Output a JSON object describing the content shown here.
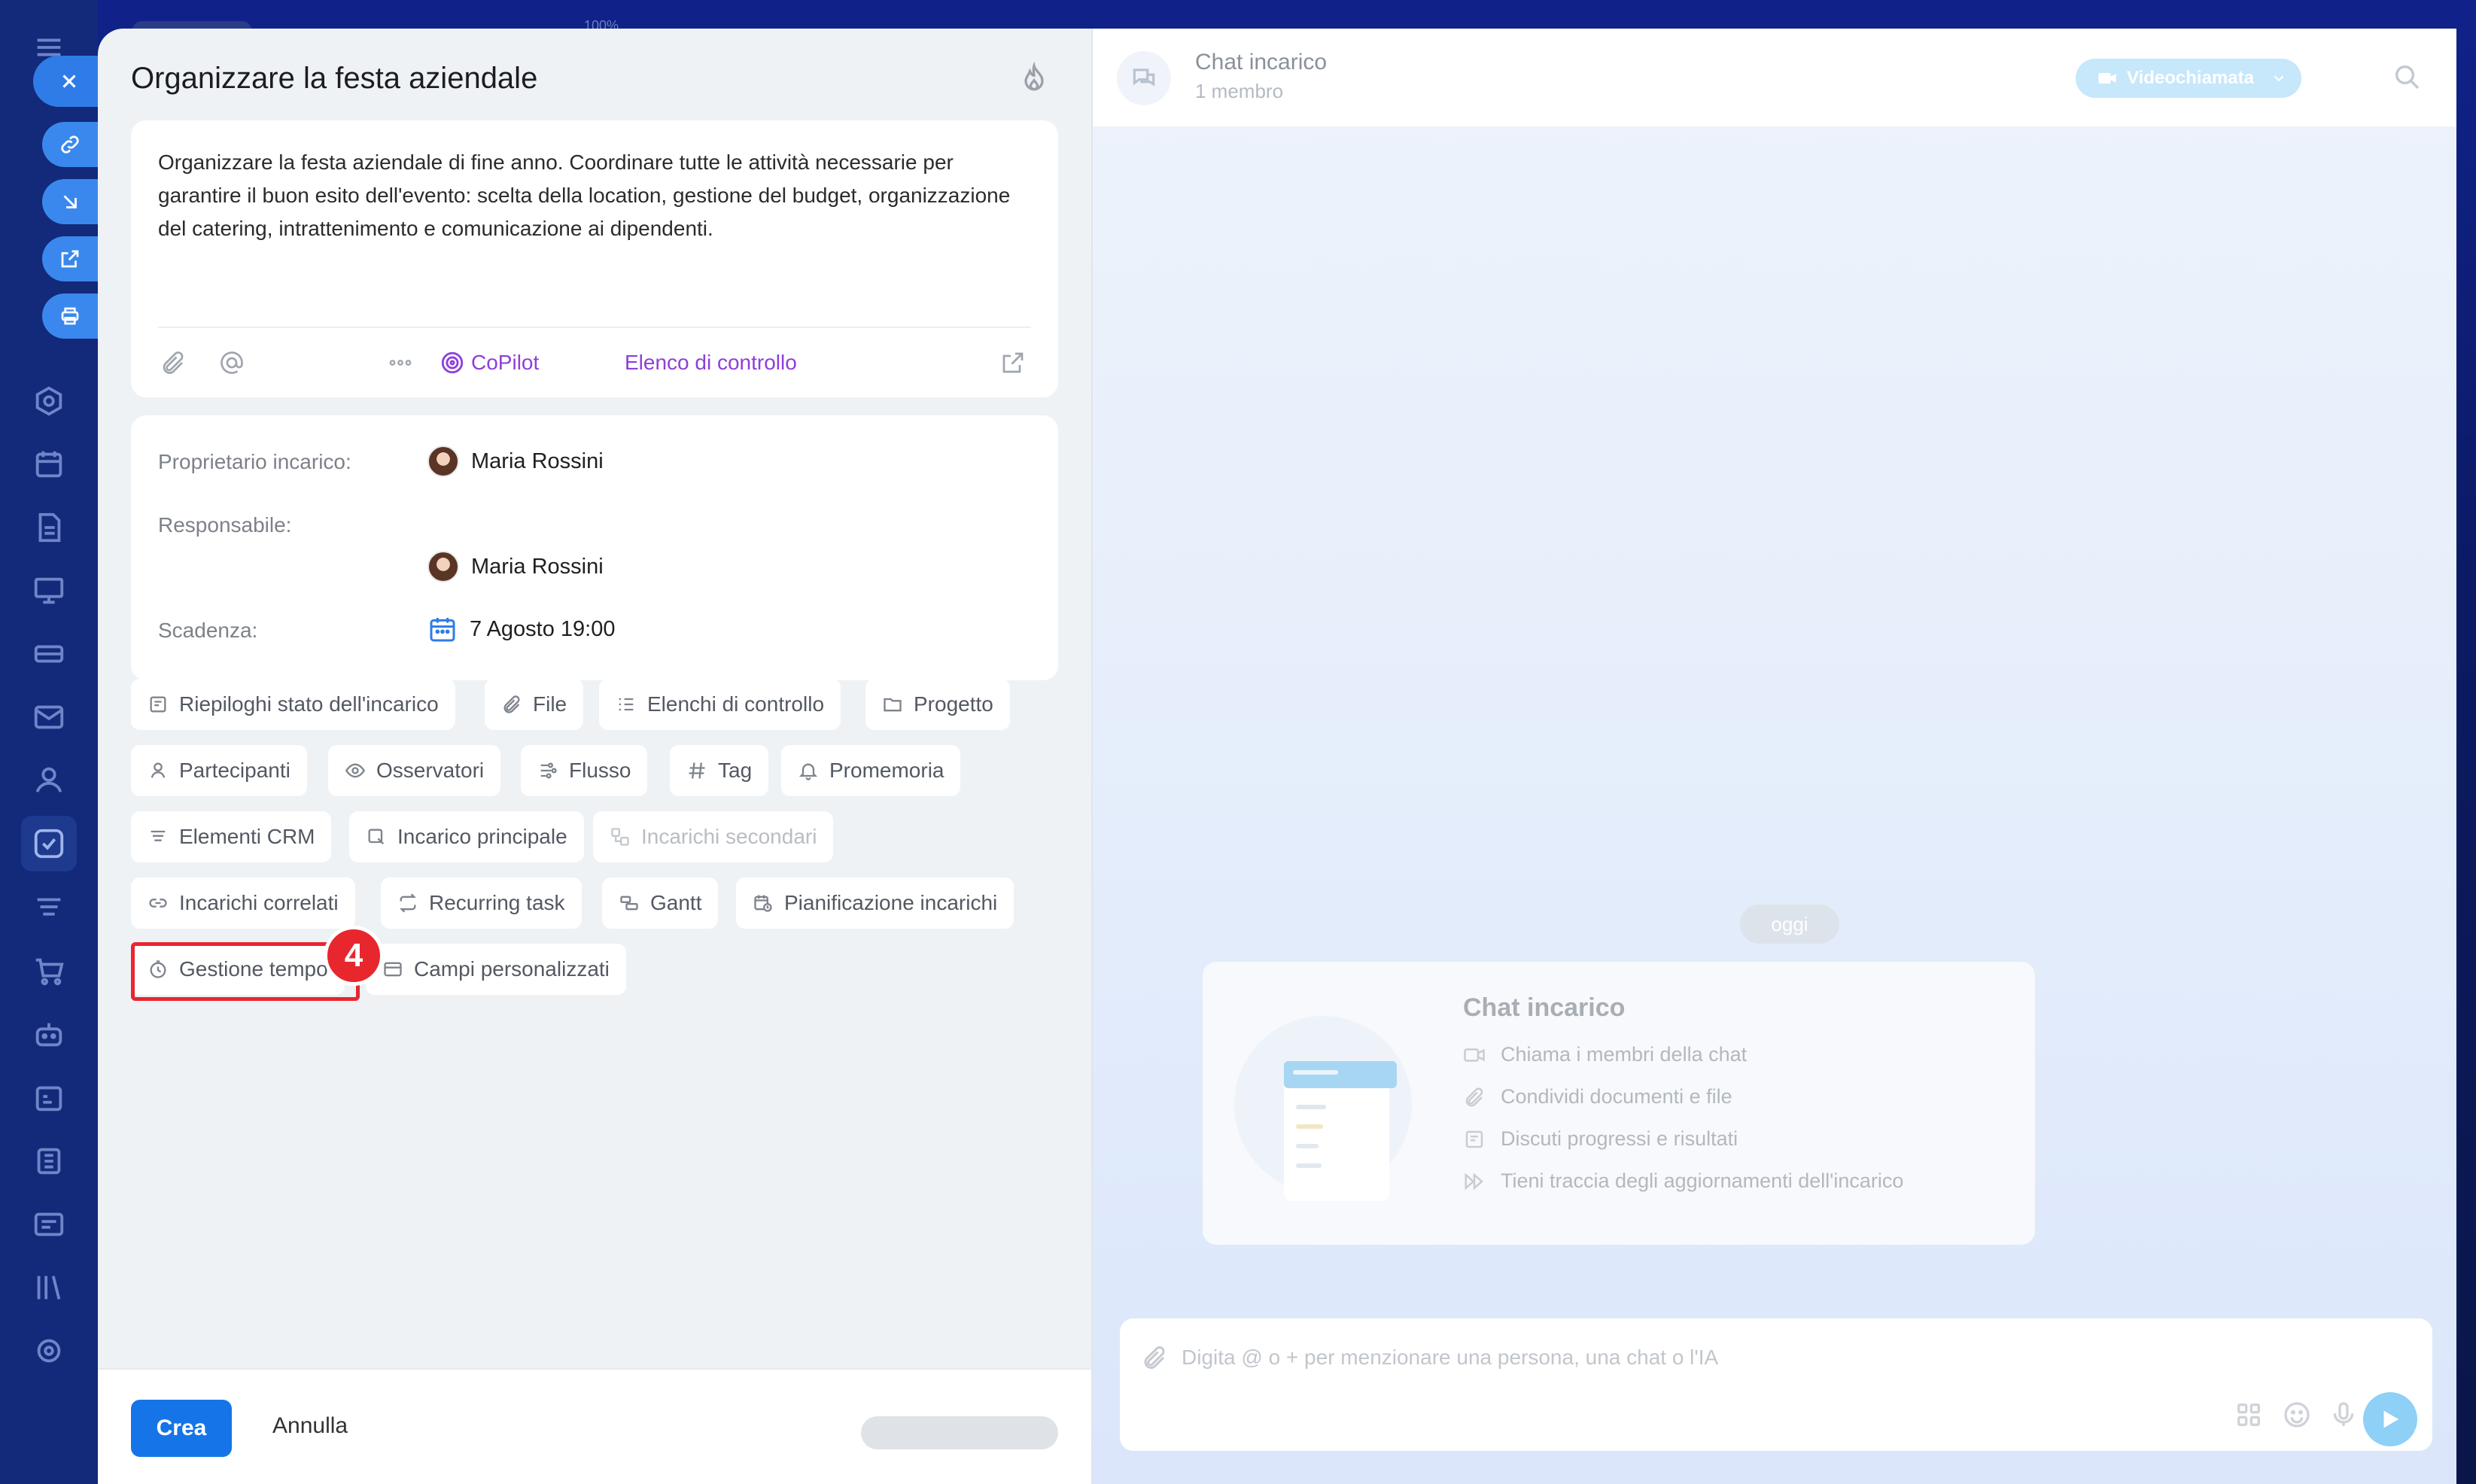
{
  "task": {
    "title": "Organizzare la festa aziendale",
    "description": "Organizzare la festa aziendale di fine anno. Coordinare tutte le attività necessarie per garantire il buon esito dell'evento: scelta della location, gestione del budget, organizzazione del catering, intrattenimento e comunicazione ai dipendenti."
  },
  "toolbar": {
    "copilot_label": "CoPilot",
    "checklist_label": "Elenco di controllo"
  },
  "fields": {
    "owner_label": "Proprietario incarico:",
    "owner_name": "Maria Rossini",
    "responsible_label": "Responsabile:",
    "responsible_name": "Maria Rossini",
    "deadline_label": "Scadenza:",
    "deadline_value": "7 Agosto 19:00"
  },
  "chips": [
    {
      "label": "Riepiloghi stato dell'incarico",
      "icon": "summary-icon"
    },
    {
      "label": "File",
      "icon": "paperclip-icon"
    },
    {
      "label": "Elenchi di controllo",
      "icon": "checklist-icon"
    },
    {
      "label": "Progetto",
      "icon": "folder-icon"
    },
    {
      "label": "Partecipanti",
      "icon": "person-icon"
    },
    {
      "label": "Osservatori",
      "icon": "eye-icon"
    },
    {
      "label": "Flusso",
      "icon": "flow-icon"
    },
    {
      "label": "Tag",
      "icon": "hash-icon"
    },
    {
      "label": "Promemoria",
      "icon": "bell-icon"
    },
    {
      "label": "Elementi CRM",
      "icon": "crm-icon"
    },
    {
      "label": "Incarico principale",
      "icon": "parent-task-icon"
    },
    {
      "label": "Incarichi secondari",
      "icon": "subtask-icon",
      "disabled": true
    },
    {
      "label": "Incarichi correlati",
      "icon": "link-icon"
    },
    {
      "label": "Recurring task",
      "icon": "repeat-icon"
    },
    {
      "label": "Gantt",
      "icon": "gantt-icon"
    },
    {
      "label": "Pianificazione incarichi",
      "icon": "calendar-clock-icon"
    },
    {
      "label": "Gestione tempo",
      "icon": "clock-icon"
    },
    {
      "label": "Campi personalizzati",
      "icon": "custom-fields-icon"
    }
  ],
  "annotation": {
    "step": "4",
    "color": "#e8262e"
  },
  "footer": {
    "create_label": "Crea",
    "cancel_label": "Annulla"
  },
  "chat": {
    "title": "Chat incarico",
    "members": "1 membro",
    "video_label": "Videochiamata",
    "date_chip": "oggi",
    "intro_title": "Chat incarico",
    "intro_items": [
      {
        "label": "Chiama i membri della chat",
        "icon": "video-icon"
      },
      {
        "label": "Condividi documenti e file",
        "icon": "paperclip-icon"
      },
      {
        "label": "Discuti progressi e risultati",
        "icon": "chat-bubble-icon"
      },
      {
        "label": "Tieni traccia degli aggiornamenti dell'incarico",
        "icon": "fast-forward-icon"
      }
    ],
    "input_placeholder": "Digita @ o + per menzionare una persona, una chat o l'IA"
  },
  "background": {
    "zoom": "100%"
  },
  "colors": {
    "primary": "#1574e8",
    "copilot": "#8e3fd8",
    "highlight": "#e8262e"
  }
}
